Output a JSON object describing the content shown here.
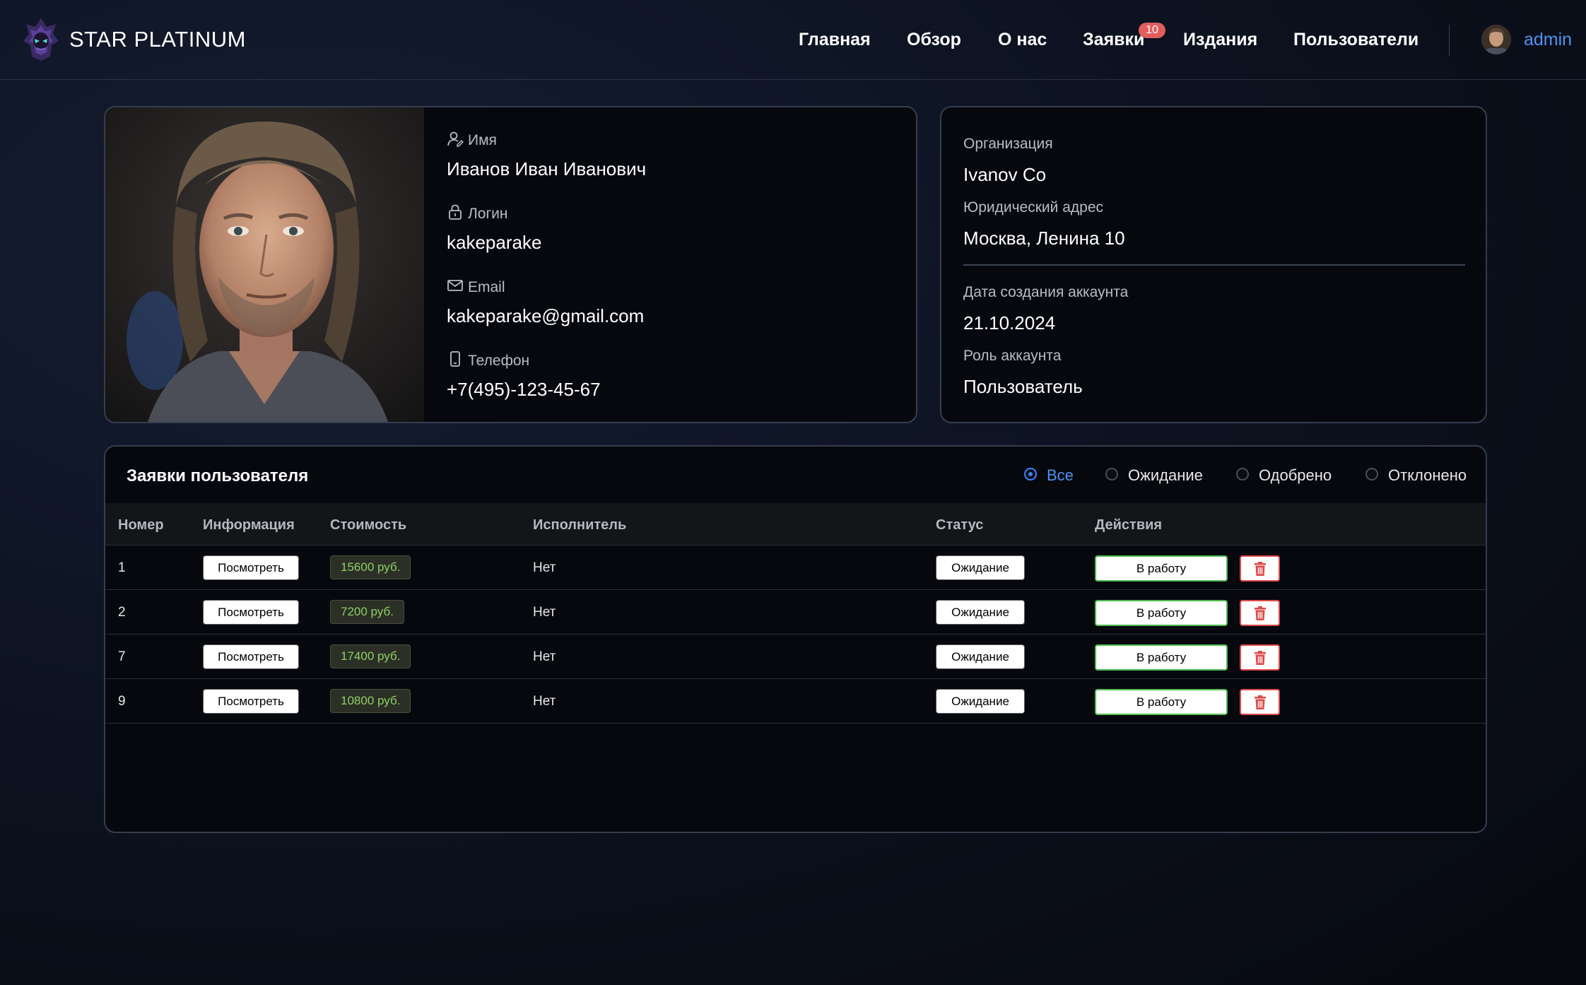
{
  "header": {
    "brand": "STAR PLATINUM",
    "nav": [
      "Главная",
      "Обзор",
      "О нас",
      "Заявки",
      "Издания",
      "Пользователи"
    ],
    "requests_badge": "10",
    "username": "admin"
  },
  "profile": {
    "name_label": "Имя",
    "name": "Иванов Иван Иванович",
    "login_label": "Логин",
    "login": "kakeparake",
    "email_label": "Email",
    "email": "kakeparake@gmail.com",
    "phone_label": "Телефон",
    "phone": "+7(495)-123-45-67"
  },
  "org": {
    "org_label": "Организация",
    "org": "Ivanov Co",
    "address_label": "Юридический адрес",
    "address": "Москва, Ленина 10",
    "created_label": "Дата создания аккаунта",
    "created": "21.10.2024",
    "role_label": "Роль аккаунта",
    "role": "Пользователь"
  },
  "requests": {
    "title": "Заявки пользователя",
    "filters": [
      "Все",
      "Ожидание",
      "Одобрено",
      "Отклонено"
    ],
    "selected_filter": "Все",
    "columns": [
      "Номер",
      "Информация",
      "Стоимость",
      "Исполнитель",
      "Статус",
      "Действия"
    ],
    "view_label": "Посмотреть",
    "work_label": "В работу",
    "rows": [
      {
        "num": "1",
        "price": "15600 руб.",
        "executor": "Нет",
        "status": "Ожидание"
      },
      {
        "num": "2",
        "price": "7200 руб.",
        "executor": "Нет",
        "status": "Ожидание"
      },
      {
        "num": "7",
        "price": "17400 руб.",
        "executor": "Нет",
        "status": "Ожидание"
      },
      {
        "num": "9",
        "price": "10800 руб.",
        "executor": "Нет",
        "status": "Ожидание"
      }
    ]
  },
  "colors": {
    "accent": "#4c93f2",
    "badge": "#e25d5d",
    "price_text": "#8cd066",
    "work_border": "#4fbb4f",
    "delete_border": "#e04a4a"
  },
  "icons": [
    "logo-icon",
    "user-icon",
    "lock-icon",
    "mail-icon",
    "phone-icon",
    "trash-icon"
  ]
}
